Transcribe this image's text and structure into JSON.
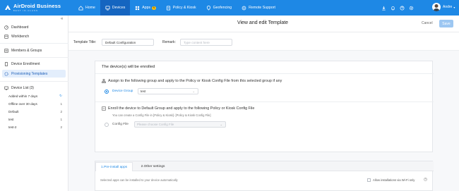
{
  "topbar": {
    "brand": "AirDroid Business",
    "brand_sub": "BEST IN-CLASS",
    "nav": [
      {
        "label": "Home",
        "icon": "home-icon"
      },
      {
        "label": "Devices",
        "icon": "devices-icon"
      },
      {
        "label": "Apps",
        "icon": "apps-icon",
        "badge": "N"
      },
      {
        "label": "Policy & Kiosk",
        "icon": "policy-icon"
      },
      {
        "label": "Geofencing",
        "icon": "geofencing-icon"
      },
      {
        "label": "Remote Support",
        "icon": "remote-support-icon"
      }
    ],
    "user": "Andre",
    "colors": {
      "bar": "#1e88e5",
      "active": "#1565c0"
    }
  },
  "sidebar": {
    "items": [
      {
        "label": "Dashboard",
        "icon": "dashboard-icon"
      },
      {
        "label": "Workbench",
        "icon": "workbench-icon"
      },
      {
        "label": "Members & Groups",
        "icon": "members-icon"
      },
      {
        "label": "Device Enrollment",
        "icon": "enrollment-icon"
      },
      {
        "label": "Provisioning Templates",
        "icon": "templates-icon"
      },
      {
        "label": "Device List (3)",
        "icon": "device-list-icon"
      }
    ],
    "device_list": [
      {
        "label": "Added within 7 days",
        "count": ""
      },
      {
        "label": "Offline over 30 days",
        "count": "1"
      },
      {
        "label": "Default",
        "count": "2"
      },
      {
        "label": "test",
        "count": "1"
      },
      {
        "label": "test-2",
        "count": "2"
      }
    ]
  },
  "header": {
    "title": "View and edit Template",
    "cancel": "Cancel",
    "save": "Save"
  },
  "form": {
    "template_title_label": "Template Title:",
    "template_title_value": "Default Configuration",
    "remark_label": "Remark:",
    "remark_placeholder": "Type content here"
  },
  "enroll": {
    "title": "The device(s) will be enrolled",
    "option1": "Assign to the following group and apply to the Policy or Kiosk Config File from this selected group if any",
    "device_group_label": "Device Group",
    "device_group_value": "test",
    "option2": "Enroll the device to Default Group and apply to the following Policy or Kiosk Config File",
    "option2_hint": "You can create a Config File in [Policy & Kiosk]- [Policy & Kiosk Config File]",
    "config_file_label": "Config File",
    "config_file_placeholder": "Please choose Config File"
  },
  "tabs": {
    "items": [
      "1.Pre-install apps",
      "2.Other settings"
    ],
    "description": "Selected apps can be installed to your device automatically",
    "wifi_label": "Allow installations via Wi-Fi only"
  }
}
